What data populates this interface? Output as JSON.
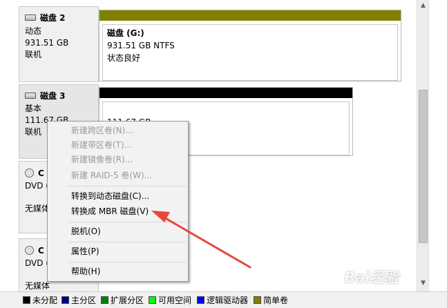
{
  "disks": [
    {
      "name": "磁盘 2",
      "type": "动态",
      "size": "931.51 GB",
      "status": "联机",
      "volume": {
        "name": "磁盘  (G:)",
        "size_fs": "931.51 GB NTFS",
        "health": "状态良好",
        "color": "#808000"
      }
    },
    {
      "name": "磁盘 3",
      "type": "基本",
      "size": "111.67 GB",
      "status": "联机",
      "volume": {
        "size": "111.67 GB",
        "color": "#000000"
      }
    }
  ],
  "cd_drives": [
    {
      "name": "C",
      "type": "DVD (",
      "status": "无媒体"
    },
    {
      "name": "C",
      "type": "DVD (",
      "status": "无媒体"
    }
  ],
  "context_menu": {
    "new_spanned": "新建跨区卷(N)...",
    "new_striped": "新建带区卷(T)...",
    "new_mirrored": "新建镜像卷(R)...",
    "new_raid5": "新建 RAID-5 卷(W)...",
    "convert_dynamic": "转换到动态磁盘(C)...",
    "convert_mbr": "转换成 MBR 磁盘(V)",
    "offline": "脱机(O)",
    "properties": "属性(P)",
    "help": "帮助(H)"
  },
  "legend": [
    {
      "label": "未分配",
      "color": "#000000"
    },
    {
      "label": "主分区",
      "color": "#000080"
    },
    {
      "label": "扩展分区",
      "color": "#008000"
    },
    {
      "label": "可用空间",
      "color": "#00ff00"
    },
    {
      "label": "逻辑驱动器",
      "color": "#0000ff"
    },
    {
      "label": "简单卷",
      "color": "#808000"
    }
  ],
  "annotation_color": "#e8453c",
  "watermark": "Bai经验"
}
